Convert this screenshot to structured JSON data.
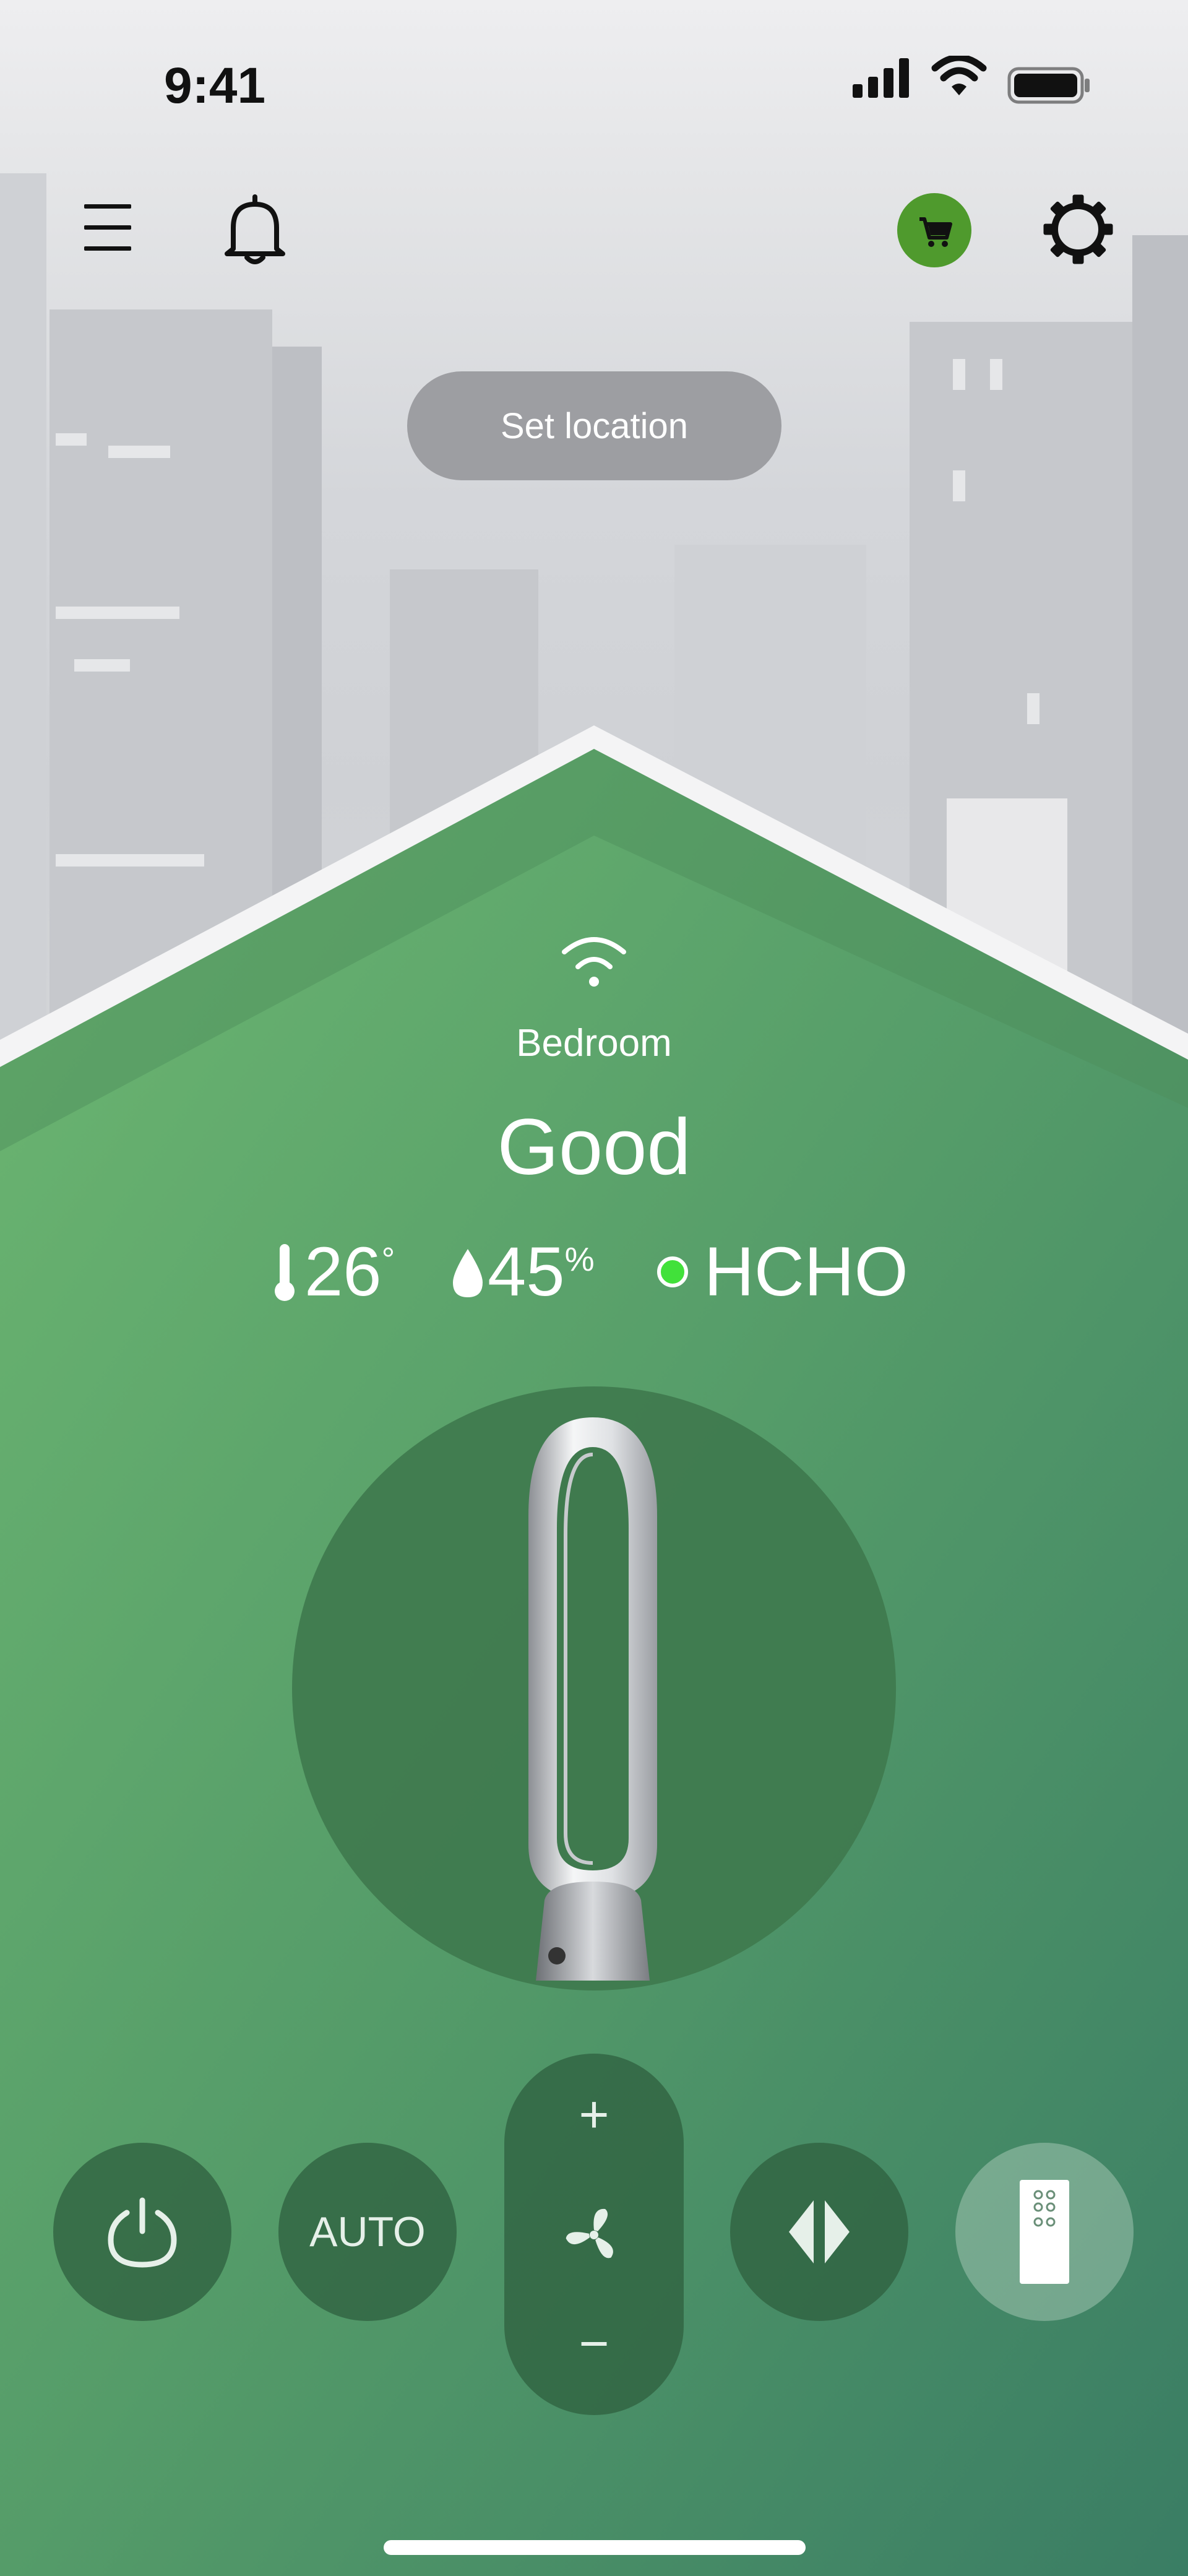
{
  "status_bar": {
    "time": "9:41"
  },
  "header": {
    "location_button": "Set location"
  },
  "room_card": {
    "room_name": "Bedroom",
    "air_quality": "Good",
    "temperature": {
      "value": "26",
      "unit": "°"
    },
    "humidity": {
      "value": "45",
      "unit": "%"
    },
    "pollutant": {
      "label": "HCHO",
      "status_color": "#41e13a"
    }
  },
  "controls": {
    "auto_label": "AUTO",
    "speed_plus": "+",
    "speed_minus": "−"
  },
  "colors": {
    "accent": "#4f9a2d",
    "house_green_top": "#6bb46e",
    "house_green_bottom": "#3a7e66",
    "status_dot": "#41e13a"
  },
  "icons": [
    "menu-icon",
    "bell-icon",
    "cart-icon",
    "gear-icon",
    "wifi-icon",
    "thermometer-icon",
    "droplet-icon",
    "power-icon",
    "fan-icon",
    "oscillation-icon",
    "remote-icon"
  ]
}
